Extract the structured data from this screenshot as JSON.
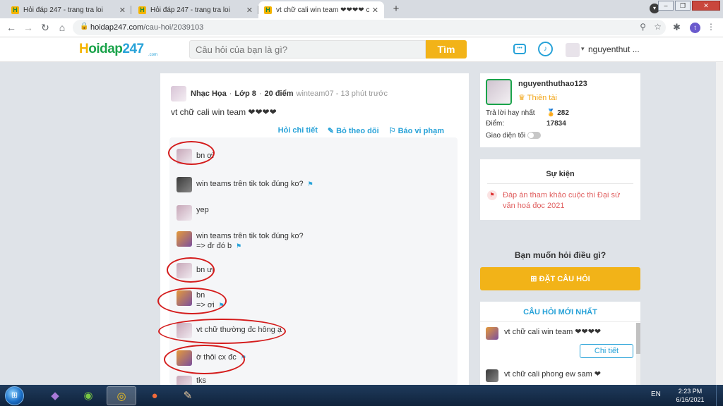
{
  "browser": {
    "tabs": [
      {
        "title": "Hỏi đáp 247 - trang tra loi",
        "active": false
      },
      {
        "title": "Hỏi đáp 247 - trang tra loi",
        "active": false
      },
      {
        "title": "vt chữ cali win team ❤❤❤❤ câu t",
        "active": true
      }
    ],
    "url_host": "hoidap247.com",
    "url_path": "/cau-hoi/2039103",
    "profile_initial": "t"
  },
  "site": {
    "logo_h": "H",
    "logo_text": "oidap",
    "logo_num": "247",
    "logo_sub": ".com",
    "search_placeholder": "Câu hỏi của bạn là gì?",
    "search_button": "Tìm",
    "username": "nguyenthut ..."
  },
  "question": {
    "subject": "Nhạc Họa",
    "grade": "Lớp 8",
    "points": "20 điểm",
    "author_time": "winteam07 - 13 phút trước",
    "title": "vt chữ cali win team ❤❤❤❤",
    "actions": [
      {
        "icon": "",
        "label": "Hỏi chi tiết"
      },
      {
        "icon": "✎",
        "label": "Bỏ theo dõi"
      },
      {
        "icon": "⚐",
        "label": "Báo vi phạm"
      }
    ]
  },
  "comments": [
    {
      "lines": [
        "bn ơi"
      ],
      "avatar": "thumb",
      "flag": false
    },
    {
      "lines": [
        "win teams trên tik tok đúng ko?"
      ],
      "avatar": "dark",
      "flag": true
    },
    {
      "lines": [
        "yep"
      ],
      "avatar": "thumb",
      "flag": false
    },
    {
      "lines": [
        "win teams trên tik tok đúng ko?",
        "=> đr đó b"
      ],
      "avatar": "multi",
      "flag": true
    },
    {
      "lines": [
        "bn ưi"
      ],
      "avatar": "thumb",
      "flag": false
    },
    {
      "lines": [
        "bn",
        "=> ơi"
      ],
      "avatar": "multi",
      "flag": true
    },
    {
      "lines": [
        "vt chữ thường đc hông ạ"
      ],
      "avatar": "thumb",
      "flag": false
    },
    {
      "lines": [
        "ờ thôi cx đc"
      ],
      "avatar": "multi",
      "flag": true
    },
    {
      "lines": [
        "tks"
      ],
      "avatar": "thumb",
      "flag": false
    }
  ],
  "profile": {
    "name": "nguyenthuthao123",
    "rank": "Thiên tài",
    "best_answers_label": "Trả lời hay nhất",
    "best_answers_value": "282",
    "points_label": "Điểm:",
    "points_value": "17834",
    "dark_mode_label": "Giao diện tối"
  },
  "events": {
    "title": "Sự kiện",
    "item": "Đáp án tham khảo cuộc thi Đại sứ văn hoá đọc 2021"
  },
  "ask": {
    "prompt": "Bạn muốn hỏi điều gì?",
    "button": "ĐẶT CÂU HỎI"
  },
  "latest": {
    "title": "CÂU HỎI MỚI NHẤT",
    "items": [
      {
        "text": "vt chữ cali win team ❤❤❤❤"
      },
      {
        "text": "vt chữ cali phong ew sam ❤"
      }
    ],
    "detail_button": "Chi tiết"
  },
  "taskbar": {
    "lang": "EN",
    "time": "2:23 PM",
    "date": "6/16/2021"
  }
}
